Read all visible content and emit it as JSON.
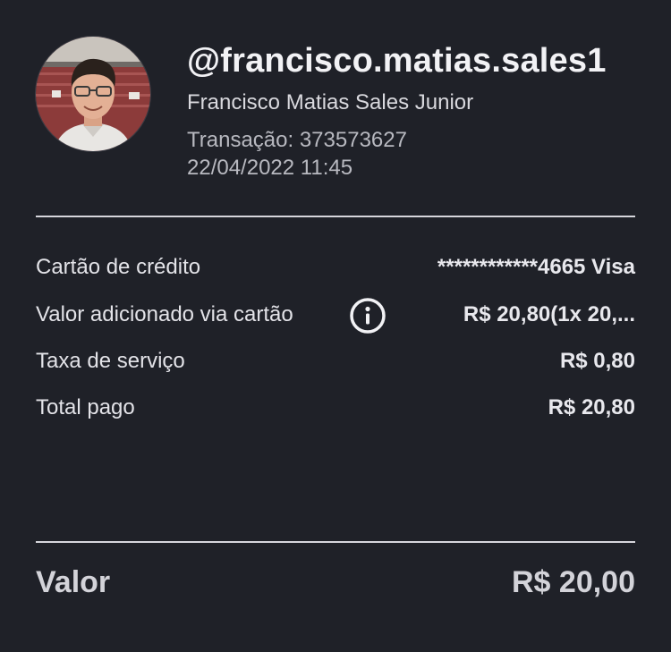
{
  "profile": {
    "username": "@francisco.matias.sales1",
    "full_name": "Francisco Matias Sales Junior",
    "transaction_label": "Transação: 373573627",
    "datetime": "22/04/2022 11:45",
    "avatar_icon": "user-photo"
  },
  "details": [
    {
      "label": "Cartão de crédito",
      "value": "************4665 Visa"
    },
    {
      "label": "Valor adicionado via cartão",
      "value": "R$ 20,80(1x 20,...",
      "icon": "info-icon"
    },
    {
      "label": "Taxa de serviço",
      "value": "R$ 0,80"
    },
    {
      "label": "Total pago",
      "value": "R$ 20,80"
    }
  ],
  "summary": {
    "label": "Valor",
    "value": "R$ 20,00"
  },
  "colors": {
    "background": "#1f2128",
    "text": "#e6e6ea",
    "divider": "#d6d6dc"
  }
}
